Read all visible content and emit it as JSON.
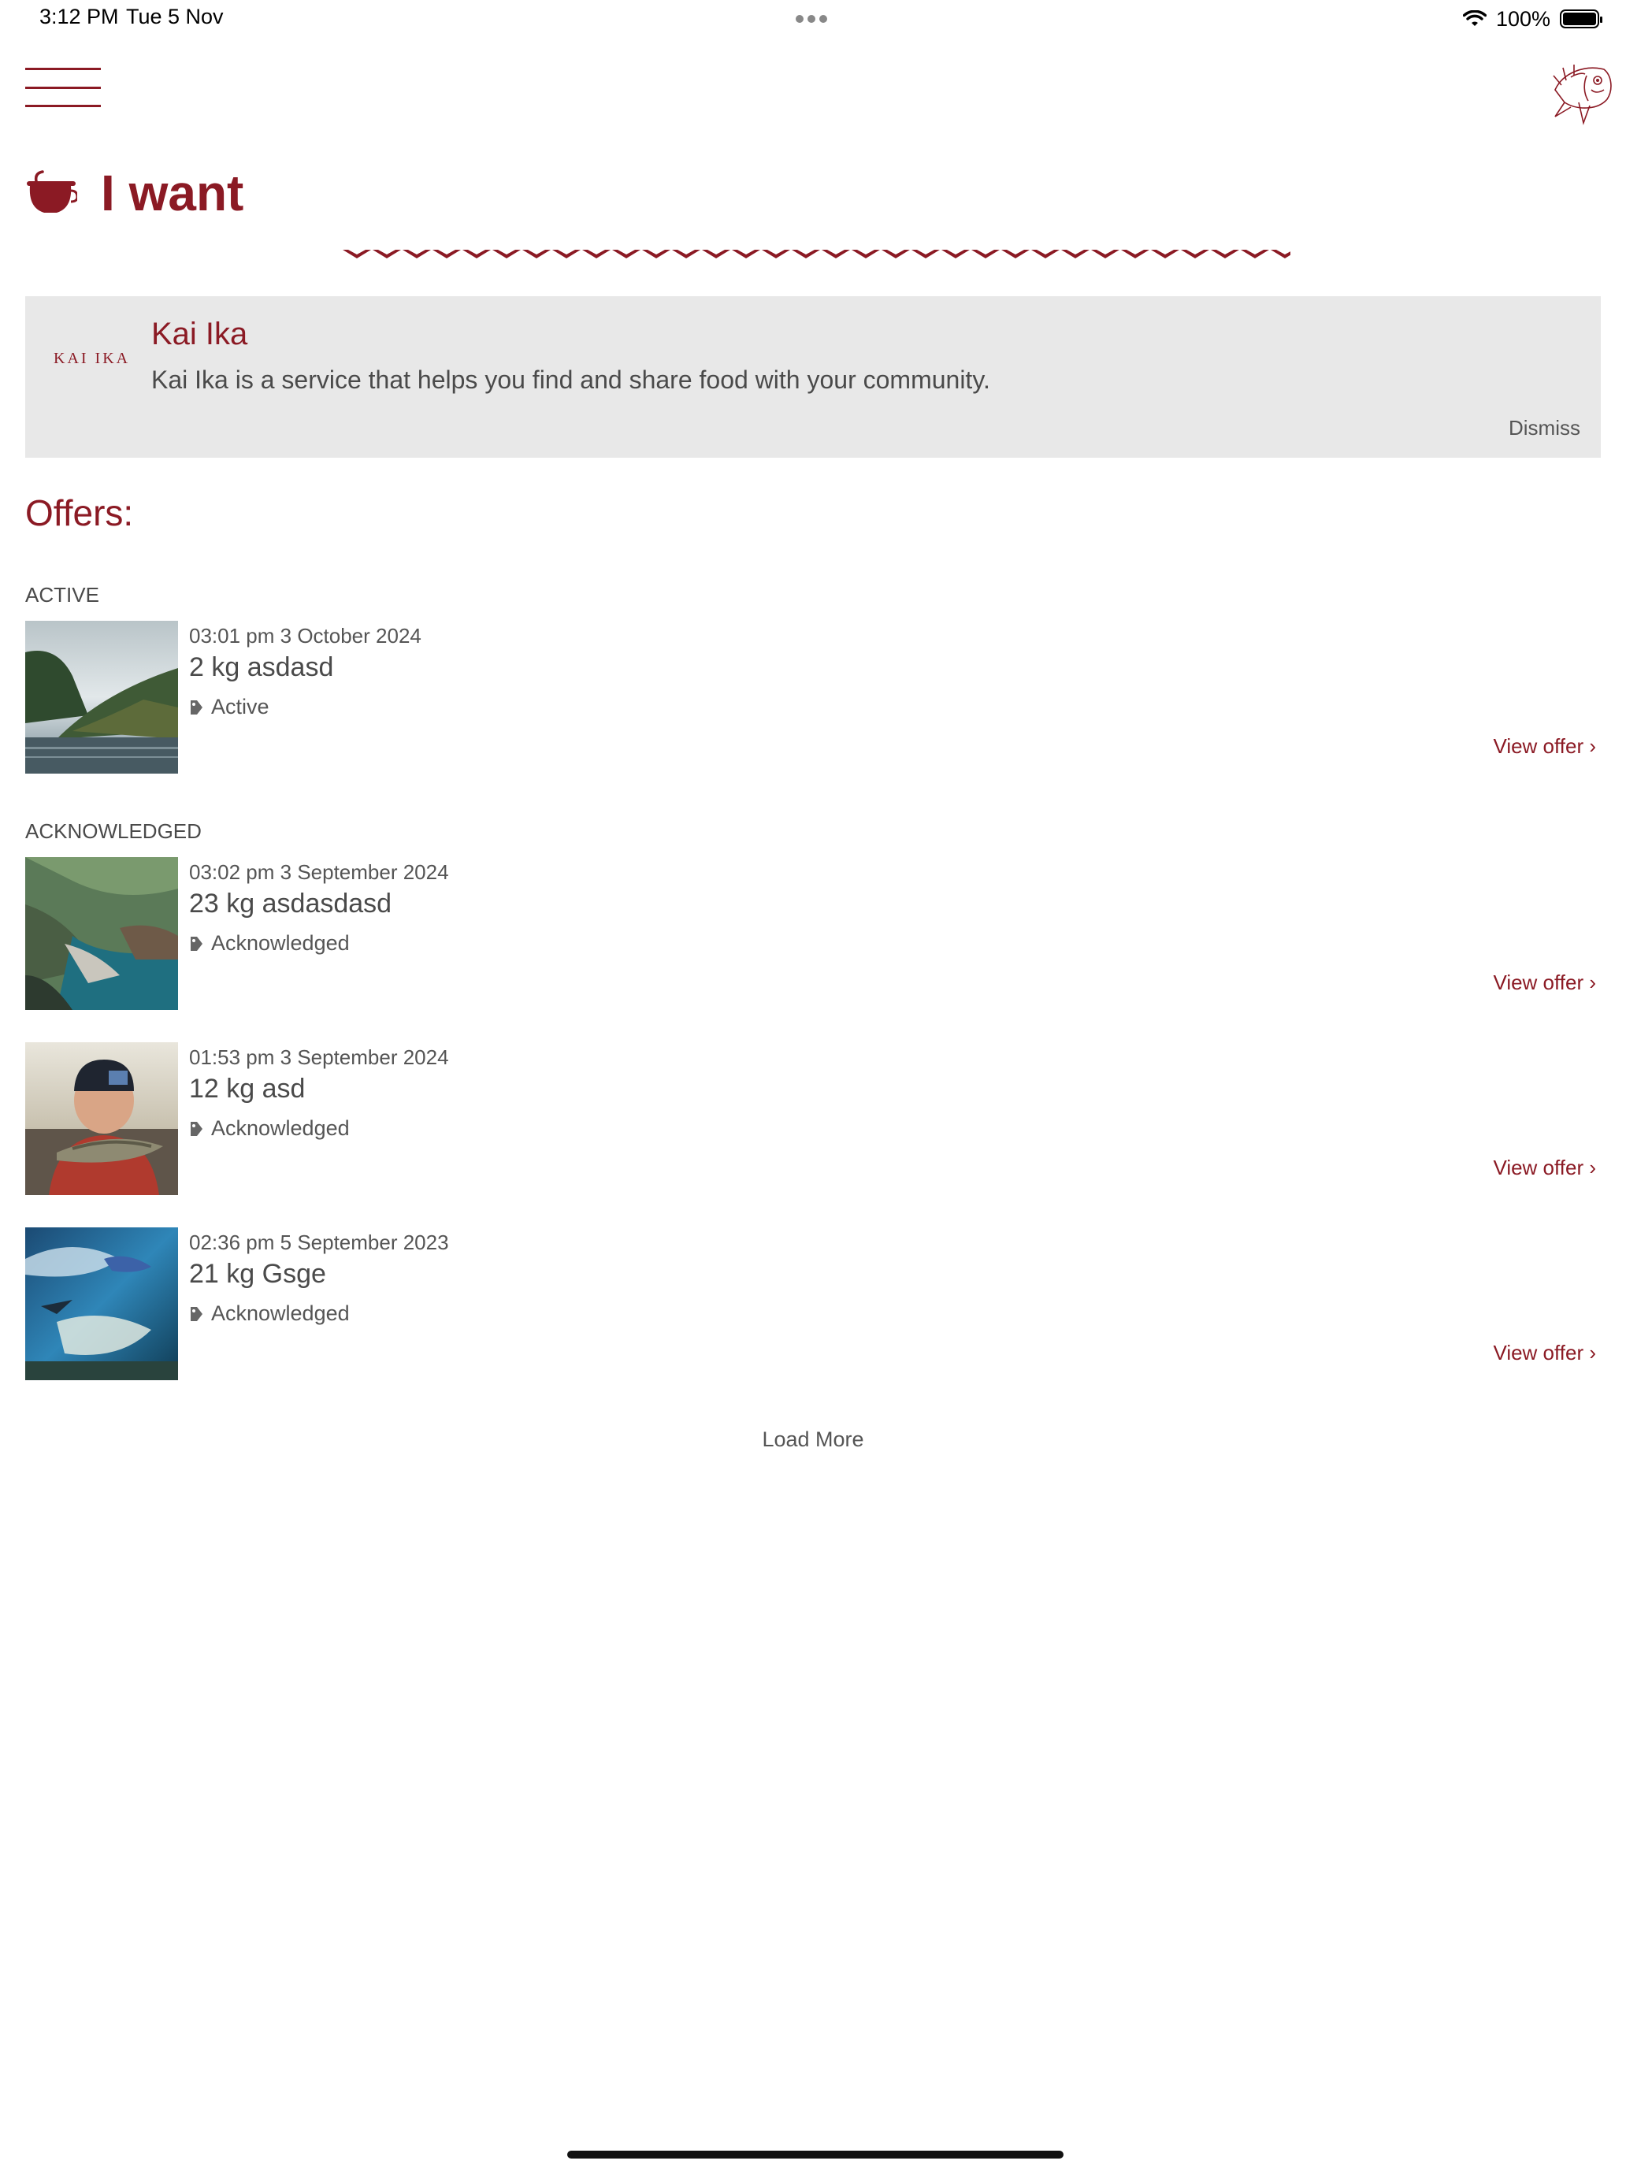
{
  "status_bar": {
    "time": "3:12 PM",
    "date": "Tue 5 Nov",
    "battery": "100%"
  },
  "header": {
    "menu_icon": "hamburger-menu-icon",
    "logo_icon": "fish-logo-icon",
    "title_icon": "pot-icon",
    "title": "I want"
  },
  "banner": {
    "logo_text": "KAI IKA",
    "title": "Kai Ika",
    "text": "Kai Ika is a service that helps you find and share food with your community.",
    "dismiss_label": "Dismiss"
  },
  "offers": {
    "heading": "Offers:",
    "sections": [
      {
        "label": "ACTIVE",
        "items": [
          {
            "date": "03:01 pm 3 October 2024",
            "title": "2 kg asdasd",
            "status": "Active",
            "link": "View offer ›",
            "image": "misty-forest-lake"
          }
        ]
      },
      {
        "label": "ACKNOWLEDGED",
        "items": [
          {
            "date": "03:02 pm 3 September 2024",
            "title": "23 kg asdasdasd",
            "status": "Acknowledged",
            "link": "View offer ›",
            "image": "coastal-cliffs"
          },
          {
            "date": "01:53 pm 3 September 2024",
            "title": "12 kg asd",
            "status": "Acknowledged",
            "link": "View offer ›",
            "image": "boy-holding-fish"
          },
          {
            "date": "02:36 pm 5 September 2023",
            "title": "21 kg Gsge",
            "status": "Acknowledged",
            "link": "View offer ›",
            "image": "underwater-reef"
          }
        ]
      }
    ],
    "load_more": "Load More"
  },
  "colors": {
    "accent": "#8b1a24",
    "banner_bg": "#e8e8e8",
    "text": "#4a4a4a"
  }
}
